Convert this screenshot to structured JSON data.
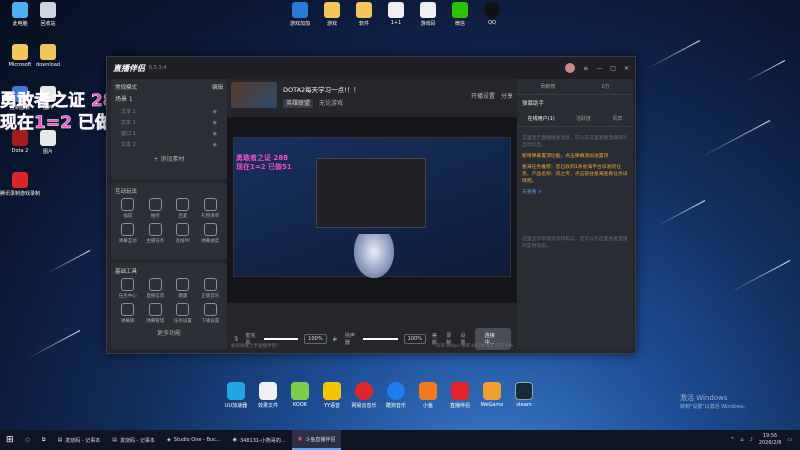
{
  "desktop": {
    "icons_left": [
      {
        "label": "此电脑"
      },
      {
        "label": "回收站"
      },
      {
        "label": "Microsoft"
      },
      {
        "label": "download"
      },
      {
        "label": "控制面板"
      },
      {
        "label": "图片"
      },
      {
        "label": "Dota 2"
      },
      {
        "label": "图片"
      },
      {
        "label": "腾讯录制游戏录制"
      }
    ],
    "icons_top": [
      {
        "label": "游戏加加"
      },
      {
        "label": "游戏"
      },
      {
        "label": "软件"
      },
      {
        "label": "1+1"
      },
      {
        "label": "游戏码"
      },
      {
        "label": "微信"
      },
      {
        "label": "QQ"
      }
    ],
    "overlay_line1": "勇敢者之证 288",
    "overlay_line2": "现在1=2 已做51",
    "watermark_line1": "激活 Windows",
    "watermark_line2": "转到\"设置\"以激活 Windows。",
    "dock": [
      {
        "label": "UU加速器",
        "color": "#1ea7e4"
      },
      {
        "label": "效果文件",
        "color": "#f0f0f0"
      },
      {
        "label": "KOOK",
        "color": "#7ad04a"
      },
      {
        "label": "YY语音",
        "color": "#f5c400"
      },
      {
        "label": "网易云音乐",
        "color": "#e0262b"
      },
      {
        "label": "酷狗音乐",
        "color": "#1e7df0"
      },
      {
        "label": "小鱼",
        "color": "#f07a1e"
      },
      {
        "label": "直播伴侣",
        "color": "#e0262b"
      },
      {
        "label": "WeGame",
        "color": "#f0a030"
      },
      {
        "label": "steam",
        "color": "#1b2838"
      }
    ]
  },
  "app": {
    "title": "直播伴侣",
    "version": "6.5.3.4",
    "room": {
      "title": "DOTA2每天学习一点!！！",
      "category": "英雄联盟",
      "tag": "无论游戏",
      "live_label": "开播设置",
      "share": "分享"
    },
    "scene": {
      "mode_label": "常规模式",
      "edit": "编辑",
      "scene_name": "场景 1",
      "items": [
        "文本 1",
        "文本 1",
        "窗口 1",
        "文本 2"
      ],
      "add_label": "添加素材"
    },
    "tools_header": "互动玩法",
    "tools": [
      "福袋",
      "抽奖",
      "连麦",
      "礼物清单",
      "弹幕互动",
      "主播任务",
      "连线PK",
      "弹幕进度"
    ],
    "base_header": "基础工具",
    "base": [
      "任务中心",
      "直播信息",
      "健康",
      "正版音乐",
      "弹幕库",
      "弹幕管理",
      "任务设置",
      "下播设置"
    ],
    "more": "更多功能",
    "preview_overlay1": "勇敢者之证 288",
    "preview_overlay2": "现在1=2 已做51",
    "controls": {
      "mic": "麦克风",
      "mic_pct": "100%",
      "speaker": "扬声器",
      "speaker_pct": "100%",
      "beauty": "美颜",
      "record": "录制",
      "settings": "设置",
      "live": "连接中..."
    },
    "status_text": "如何快速上手直播伴侣?",
    "status_right": "码率:0kbps  帧率:0  CPU:4%  内存:0%",
    "right": {
      "top_stats": [
        "贡献榜",
        "0万"
      ],
      "tabs": [
        "在线用户(1)",
        "活跃度",
        "贵宾"
      ],
      "title": "弹幕助手",
      "messages": [
        {
          "text": "这里显示直播相关消息，可以在这里查看直播观众互动信息。",
          "cls": ""
        },
        {
          "text": "新增弹幕置顶功能，点击弹幕添加进置顶",
          "cls": "hl"
        },
        {
          "text": "星海任务推荐：您已收到1条星海平台派发的任务，产品名称：风之传，点击前往星海查看任务详情吧。",
          "cls": "hl"
        },
        {
          "text": "去查看 >",
          "cls": "bl"
        },
        {
          "text": "这里显示新增消息和私信，您可以在这里查看直播间实时动态。",
          "cls": ""
        }
      ]
    }
  },
  "taskbar": {
    "items": [
      "发烧码 - 记事本",
      "发烧码 - 记事本",
      "Studio One - Buc...",
      "348131-小熊哥的...",
      "斗鱼直播伴侣"
    ],
    "time": "19:56",
    "date": "2026/2/8"
  }
}
